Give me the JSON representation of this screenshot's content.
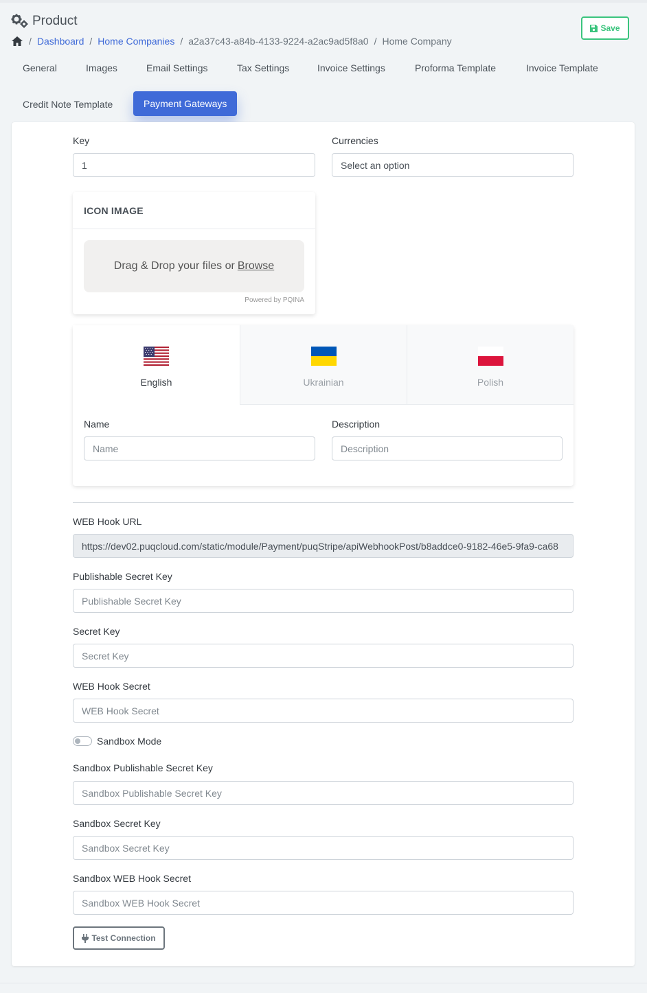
{
  "header": {
    "title": "Product",
    "title_icon": "gears-icon",
    "save_label": "Save",
    "save_icon": "floppy-disk-icon",
    "accent_color": "#3f6ad8",
    "save_color": "#3ac47d"
  },
  "breadcrumb": {
    "home_icon": "home-icon",
    "separator": "/",
    "items": [
      "Dashboard",
      "Home Companies",
      "a2a37c43-a84b-4133-9224-a2ac9ad5f8a0",
      "Home Company"
    ]
  },
  "tabs": [
    {
      "label": "General"
    },
    {
      "label": "Images"
    },
    {
      "label": "Email Settings"
    },
    {
      "label": "Tax Settings"
    },
    {
      "label": "Invoice Settings"
    },
    {
      "label": "Proforma Template"
    },
    {
      "label": "Invoice Template"
    },
    {
      "label": "Credit Note Template"
    },
    {
      "label": "Payment Gateways",
      "active": true
    }
  ],
  "form": {
    "key_label": "Key",
    "key_value": "1",
    "currencies_label": "Currencies",
    "currencies_value": "Select an option",
    "icon_image": {
      "title": "ICON IMAGE",
      "drop_text": "Drag & Drop your files or",
      "browse_label": "Browse",
      "powered": "Powered by PQINA"
    },
    "languages": [
      {
        "label": "English",
        "flag": "us-flag-icon",
        "active": true
      },
      {
        "label": "Ukrainian",
        "flag": "ukraine-flag-icon"
      },
      {
        "label": "Polish",
        "flag": "poland-flag-icon"
      }
    ],
    "name_label": "Name",
    "name_placeholder": "Name",
    "description_label": "Description",
    "description_placeholder": "Description",
    "webhook_url_label": "WEB Hook URL",
    "webhook_url_value": "https://dev02.puqcloud.com/static/module/Payment/puqStripe/apiWebhookPost/b8addce0-9182-46e5-9fa9-ca68",
    "publishable_key_label": "Publishable Secret Key",
    "publishable_key_placeholder": "Publishable Secret Key",
    "secret_key_label": "Secret Key",
    "secret_key_placeholder": "Secret Key",
    "webhook_secret_label": "WEB Hook Secret",
    "webhook_secret_placeholder": "WEB Hook Secret",
    "sandbox_mode_label": "Sandbox Mode",
    "sandbox_mode_on": false,
    "sandbox_publishable_label": "Sandbox Publishable Secret Key",
    "sandbox_publishable_placeholder": "Sandbox Publishable Secret Key",
    "sandbox_secret_label": "Sandbox Secret Key",
    "sandbox_secret_placeholder": "Sandbox Secret Key",
    "sandbox_webhook_label": "Sandbox WEB Hook Secret",
    "sandbox_webhook_placeholder": "Sandbox WEB Hook Secret",
    "test_button_label": "Test Connection",
    "test_button_icon": "plug-icon"
  }
}
